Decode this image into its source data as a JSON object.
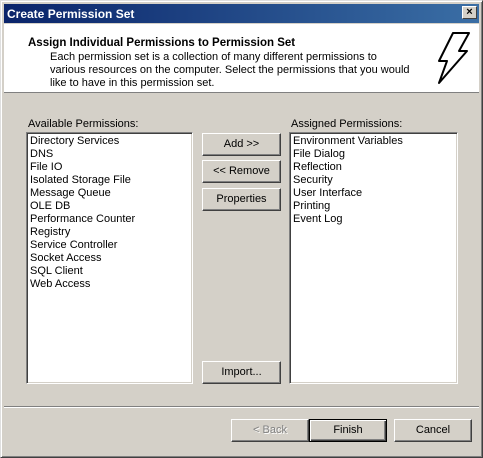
{
  "window": {
    "title": "Create Permission Set",
    "close_label": "×"
  },
  "header": {
    "title": "Assign Individual Permissions to Permission Set",
    "description": "Each permission set is a collection of many different permissions to various resources on the computer.  Select the permissions that you would like to have in this permission set.",
    "icon": "lightning-bolt-icon"
  },
  "available": {
    "label": "Available Permissions:",
    "items": [
      "Directory Services",
      "DNS",
      "File IO",
      "Isolated Storage File",
      "Message Queue",
      "OLE DB",
      "Performance Counter",
      "Registry",
      "Service Controller",
      "Socket Access",
      "SQL Client",
      "Web Access"
    ]
  },
  "assigned": {
    "label": "Assigned Permissions:",
    "items": [
      "Environment Variables",
      "File Dialog",
      "Reflection",
      "Security",
      "User Interface",
      "Printing",
      "Event Log"
    ]
  },
  "buttons": {
    "add": "Add >>",
    "remove": "<< Remove",
    "properties": "Properties",
    "import": "Import...",
    "back": "< Back",
    "finish": "Finish",
    "cancel": "Cancel"
  },
  "colors": {
    "titlebar": "#0a246a",
    "face": "#d4d0c8"
  }
}
